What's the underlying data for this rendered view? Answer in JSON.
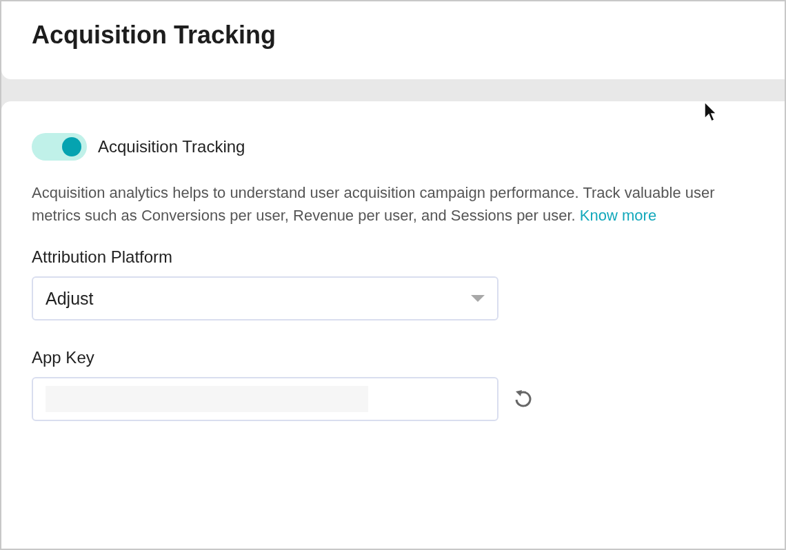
{
  "header": {
    "title": "Acquisition Tracking"
  },
  "toggle": {
    "label": "Acquisition Tracking",
    "on": true
  },
  "description": {
    "text": "Acquisition analytics helps to understand user acquisition campaign performance. Track valuable user metrics such as Conversions per user, Revenue per user, and Sessions per user.",
    "link": "Know more"
  },
  "fields": [
    {
      "kind": "dropdown",
      "label": "Attribution Platform",
      "value": "Adjust"
    },
    {
      "kind": "masked",
      "label": "App Key"
    }
  ]
}
